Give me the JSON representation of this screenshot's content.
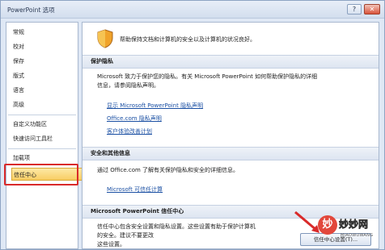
{
  "window": {
    "title": "PowerPoint 选项"
  },
  "titlebar": {
    "help_glyph": "?",
    "close_glyph": "✕"
  },
  "sidebar": {
    "items": [
      {
        "label": "常规"
      },
      {
        "label": "校对"
      },
      {
        "label": "保存"
      },
      {
        "label": "版式"
      },
      {
        "label": "语言"
      },
      {
        "label": "高级"
      },
      {
        "label": "自定义功能区"
      },
      {
        "label": "快速访问工具栏"
      },
      {
        "label": "加载项"
      },
      {
        "label": "信任中心"
      }
    ],
    "selected": "信任中心"
  },
  "content": {
    "intro": "帮助保持文档和计算机的安全以及计算机的状况良好。",
    "privacy": {
      "heading": "保护隐私",
      "text_line1": "Microsoft 致力于保护您的隐私。有关 Microsoft PowerPoint 如何帮助保护隐私的详细",
      "text_line2": "信息，请参阅隐私声明。",
      "links": [
        "显示 Microsoft PowerPoint 隐私声明",
        "Office.com 隐私声明",
        "客户体验改善计划"
      ]
    },
    "security": {
      "heading": "安全和其他信息",
      "text": "通过 Office.com 了解有关保护隐私和安全的详细信息。",
      "link": "Microsoft 可信任计算"
    },
    "trust_center": {
      "heading": "Microsoft PowerPoint 信任中心",
      "text_line1": "信任中心包含安全设置和隐私设置。这些设置有助于保护计算机",
      "text_line2": "的安全。建议不要更改",
      "text_line3": "这些设置。",
      "button": "信任中心设置(T)..."
    }
  },
  "watermark": {
    "glyph": "妙",
    "text": "妙妙网",
    "sub": "MIAOWUWANG"
  },
  "colors": {
    "highlight": "#d92a2a",
    "link": "#1a4fa3",
    "selected_bg": "#f8cd63"
  }
}
